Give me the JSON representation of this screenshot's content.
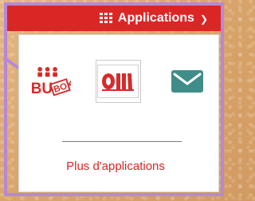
{
  "header": {
    "apps_label": "Applications"
  },
  "menu": {
    "items": [
      {
        "name": "BUBOX",
        "icon": "bubox-icon"
      },
      {
        "name": "catalogue",
        "icon": "catalogue-icon"
      },
      {
        "name": "mail",
        "icon": "mail-icon"
      }
    ],
    "more_link": "Plus d'applications"
  },
  "colors": {
    "brand": "#db2626",
    "highlight": "#b788d6",
    "mail_teal": "#3e8d88"
  }
}
